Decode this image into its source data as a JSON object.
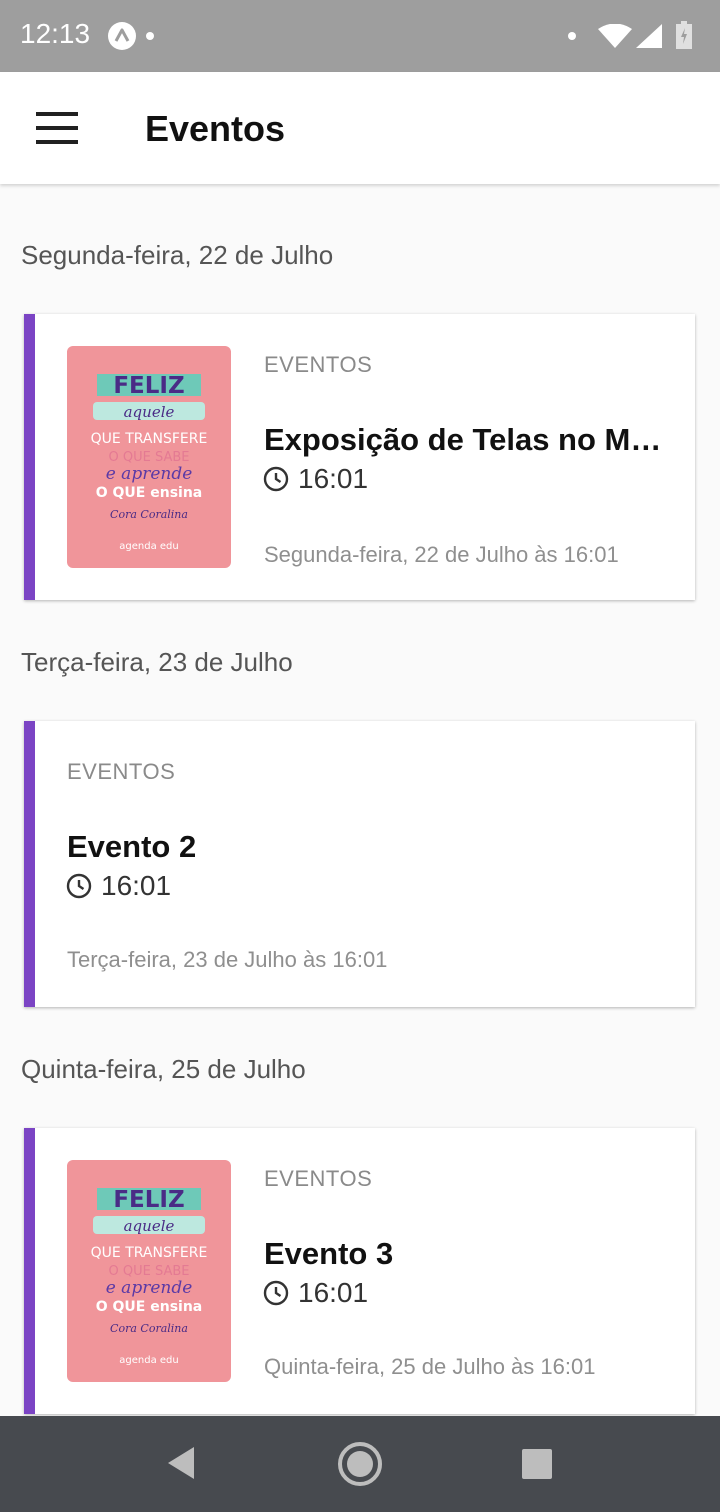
{
  "status_bar": {
    "time": "12:13",
    "icons": [
      "app-notification-icon",
      "dot-icon",
      "wifi-icon",
      "signal-icon",
      "battery-icon"
    ]
  },
  "app_bar": {
    "menu_icon": "hamburger-menu-icon",
    "title": "Eventos"
  },
  "sections": [
    {
      "date": "Segunda-feira, 22 de Julho",
      "event": {
        "category": "EVENTOS",
        "title": "Exposição de Telas no Museu",
        "time": "16:01",
        "date_line": "Segunda-feira, 22 de Julho às 16:01",
        "has_image": true,
        "image_text": [
          "FELIZ",
          "aquele",
          "QUE TRANSFERE",
          "O QUE SABE",
          "e aprende",
          "O QUE ensina",
          "Cora Coralina",
          "agenda edu"
        ]
      }
    },
    {
      "date": "Terça-feira, 23 de Julho",
      "event": {
        "category": "EVENTOS",
        "title": "Evento 2",
        "time": "16:01",
        "date_line": "Terça-feira, 23 de Julho às 16:01",
        "has_image": false
      }
    },
    {
      "date": "Quinta-feira, 25 de Julho",
      "event": {
        "category": "EVENTOS",
        "title": "Evento 3",
        "time": "16:01",
        "date_line": "Quinta-feira, 25 de Julho às 16:01",
        "has_image": true,
        "image_text": [
          "FELIZ",
          "aquele",
          "QUE TRANSFERE",
          "O QUE SABE",
          "e aprende",
          "O QUE ensina",
          "Cora Coralina",
          "agenda edu"
        ]
      }
    }
  ],
  "colors": {
    "accent": "#7b44c4",
    "thumbnail_bg": "#f0959a",
    "status_bar": "#9e9e9e",
    "nav_bar": "#474a4f"
  },
  "nav_bar": {
    "icons": [
      "back-icon",
      "home-icon",
      "recents-icon"
    ]
  }
}
